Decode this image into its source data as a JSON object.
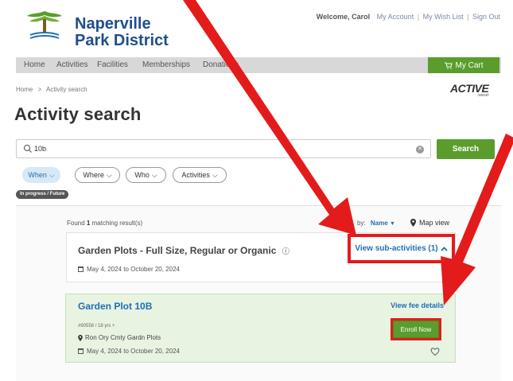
{
  "brand": {
    "line1": "Naperville",
    "line2": "Park District",
    "logo_caption": "Naperville Park District"
  },
  "top_links": {
    "welcome": "Welcome, Carol",
    "items": [
      "My Account",
      "My Wish List",
      "Sign Out"
    ]
  },
  "nav": {
    "items": [
      "Home",
      "Activities",
      "Facilities",
      "Memberships",
      "Donations"
    ],
    "cart_label": "My Cart"
  },
  "breadcrumb": {
    "home": "Home",
    "separator": ">",
    "current": "Activity search"
  },
  "active_logo": {
    "text": "ACTIVE",
    "sub": "network"
  },
  "page_title": "Activity search",
  "search": {
    "value": "10b",
    "button_label": "Search",
    "clear_icon": "clear-icon",
    "search_icon": "search-icon"
  },
  "filters": [
    {
      "label": "When",
      "selected": true
    },
    {
      "label": "Where",
      "selected": false
    },
    {
      "label": "Who",
      "selected": false
    },
    {
      "label": "Activities",
      "selected": false
    }
  ],
  "status_tag": "In progress / Future",
  "results": {
    "found_prefix": "Found",
    "found_count": "1",
    "found_suffix": "matching result(s)",
    "sort_label": "by:",
    "sort_value": "Name",
    "map_view": "Map view"
  },
  "parent_activity": {
    "title": "Garden Plots - Full Size, Regular or Organic",
    "dates": "May 4, 2024 to October 20, 2024",
    "sub_activities_link": "View sub-activities (1)"
  },
  "sub_activity": {
    "title": "Garden Plot 10B",
    "fee_link": "View fee details",
    "meta": "#90558 / 18 yrs +",
    "location": "Ron Ory Cmty Gardn Plots",
    "dates": "May 4, 2024 to October 20, 2024",
    "enroll_label": "Enroll Now"
  },
  "colors": {
    "brand_blue": "#1f4e8c",
    "green": "#5a9d2d",
    "link_blue": "#1e6fb5",
    "annotation_red": "#e41b1b",
    "card_green_bg": "#e8f3e2"
  }
}
